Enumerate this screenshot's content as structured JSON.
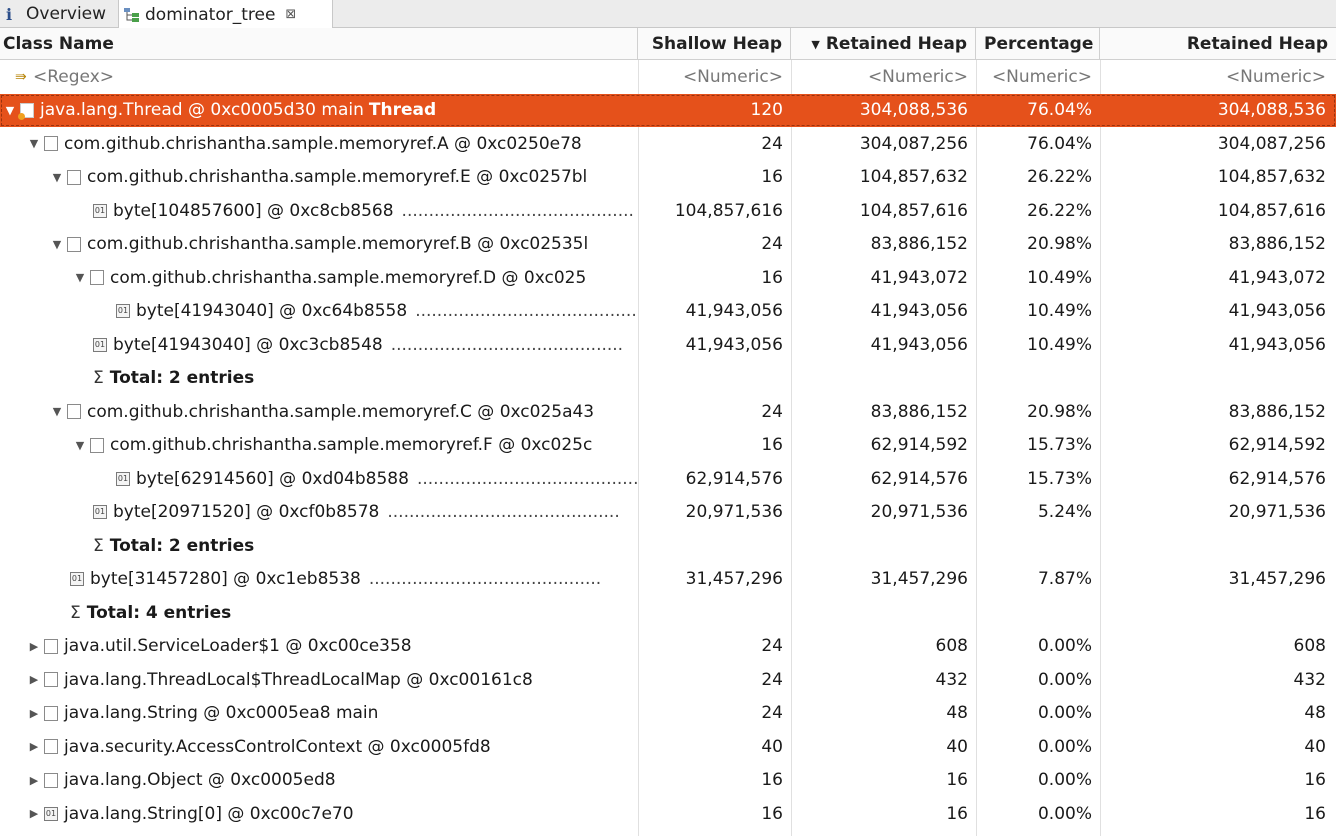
{
  "tabs": [
    {
      "label": "Overview",
      "icon": "info-icon"
    },
    {
      "label": "dominator_tree",
      "icon": "tree-icon",
      "close": "⊠"
    }
  ],
  "columns": [
    "Class Name",
    "Shallow Heap",
    "Retained Heap",
    "Percentage",
    "Retained Heap"
  ],
  "filter_row": {
    "name": "<Regex>",
    "c1": "<Numeric>",
    "c2": "<Numeric>",
    "c3": "<Numeric>",
    "c4": "<Numeric>"
  },
  "rows": [
    {
      "name": "java.lang.Thread @ 0xc0005d30  main",
      "suffix": "Thread",
      "c1": "120",
      "c2": "304,088,536",
      "c3": "76.04%",
      "c4": "304,088,536"
    },
    {
      "name": "com.github.chrishantha.sample.memoryref.A @ 0xc0250e78",
      "c1": "24",
      "c2": "304,087,256",
      "c3": "76.04%",
      "c4": "304,087,256"
    },
    {
      "name": "com.github.chrishantha.sample.memoryref.E @ 0xc0257bl",
      "c1": "16",
      "c2": "104,857,632",
      "c3": "26.22%",
      "c4": "104,857,632"
    },
    {
      "name": "byte[104857600] @ 0xc8cb8568",
      "c1": "104,857,616",
      "c2": "104,857,616",
      "c3": "26.22%",
      "c4": "104,857,616"
    },
    {
      "name": "com.github.chrishantha.sample.memoryref.B @ 0xc02535l",
      "c1": "24",
      "c2": "83,886,152",
      "c3": "20.98%",
      "c4": "83,886,152"
    },
    {
      "name": "com.github.chrishantha.sample.memoryref.D @ 0xc025",
      "c1": "16",
      "c2": "41,943,072",
      "c3": "10.49%",
      "c4": "41,943,072"
    },
    {
      "name": "byte[41943040] @ 0xc64b8558",
      "c1": "41,943,056",
      "c2": "41,943,056",
      "c3": "10.49%",
      "c4": "41,943,056"
    },
    {
      "name": "byte[41943040] @ 0xc3cb8548",
      "c1": "41,943,056",
      "c2": "41,943,056",
      "c3": "10.49%",
      "c4": "41,943,056"
    },
    {
      "name": "Total: 2 entries"
    },
    {
      "name": "com.github.chrishantha.sample.memoryref.C @ 0xc025a43",
      "c1": "24",
      "c2": "83,886,152",
      "c3": "20.98%",
      "c4": "83,886,152"
    },
    {
      "name": "com.github.chrishantha.sample.memoryref.F @ 0xc025c",
      "c1": "16",
      "c2": "62,914,592",
      "c3": "15.73%",
      "c4": "62,914,592"
    },
    {
      "name": "byte[62914560] @ 0xd04b8588",
      "c1": "62,914,576",
      "c2": "62,914,576",
      "c3": "15.73%",
      "c4": "62,914,576"
    },
    {
      "name": "byte[20971520] @ 0xcf0b8578",
      "c1": "20,971,536",
      "c2": "20,971,536",
      "c3": "5.24%",
      "c4": "20,971,536"
    },
    {
      "name": "Total: 2 entries"
    },
    {
      "name": "byte[31457280] @ 0xc1eb8538",
      "c1": "31,457,296",
      "c2": "31,457,296",
      "c3": "7.87%",
      "c4": "31,457,296"
    },
    {
      "name": "Total: 4 entries"
    },
    {
      "name": "java.util.ServiceLoader$1 @ 0xc00ce358",
      "c1": "24",
      "c2": "608",
      "c3": "0.00%",
      "c4": "608"
    },
    {
      "name": "java.lang.ThreadLocal$ThreadLocalMap @ 0xc00161c8",
      "c1": "24",
      "c2": "432",
      "c3": "0.00%",
      "c4": "432"
    },
    {
      "name": "java.lang.String @ 0xc0005ea8  main",
      "c1": "24",
      "c2": "48",
      "c3": "0.00%",
      "c4": "48"
    },
    {
      "name": "java.security.AccessControlContext @ 0xc0005fd8",
      "c1": "40",
      "c2": "40",
      "c3": "0.00%",
      "c4": "40"
    },
    {
      "name": "java.lang.Object @ 0xc0005ed8",
      "c1": "16",
      "c2": "16",
      "c3": "0.00%",
      "c4": "16"
    },
    {
      "name": "java.lang.String[0] @ 0xc00c7e70",
      "c1": "16",
      "c2": "16",
      "c3": "0.00%",
      "c4": "16"
    }
  ],
  "dots": "...........................................",
  "sigma": "Σ",
  "colors": {
    "selection": "#e5511b",
    "icon_accent": "#f0a020"
  }
}
